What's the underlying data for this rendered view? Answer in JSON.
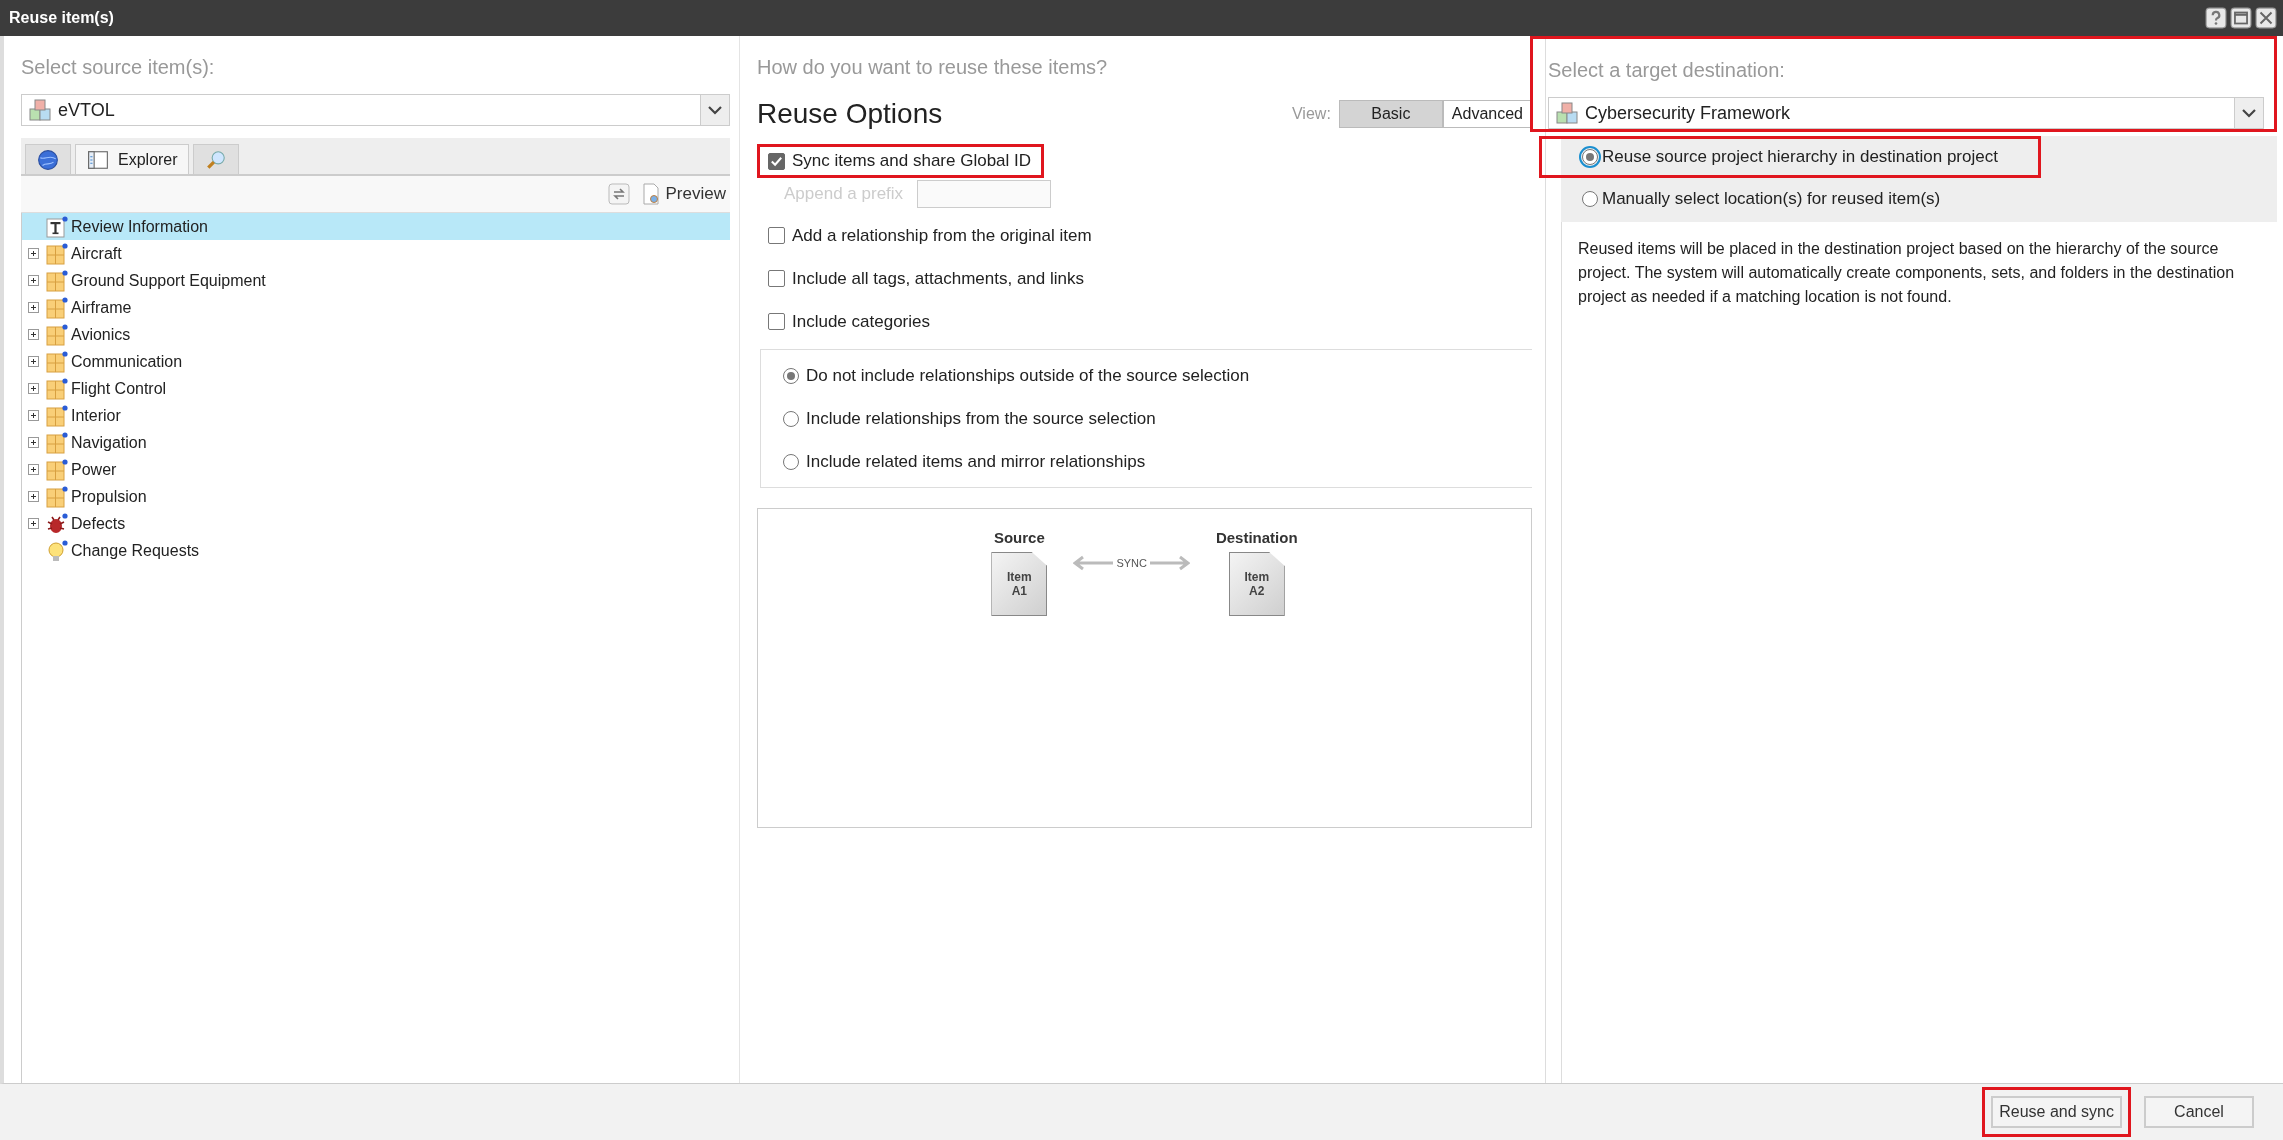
{
  "window": {
    "title": "Reuse item(s)"
  },
  "source": {
    "heading": "Select source item(s):",
    "project": "eVTOL",
    "tabs": [
      {
        "kind": "globe",
        "selected": false
      },
      {
        "kind": "explorer",
        "label": "Explorer",
        "selected": true
      },
      {
        "kind": "search",
        "selected": false
      }
    ],
    "preview": "Preview",
    "tree": [
      {
        "label": "Review Information",
        "kind": "text",
        "expandable": false,
        "selected": true
      },
      {
        "label": "Aircraft",
        "kind": "folder",
        "expandable": true,
        "selected": false
      },
      {
        "label": "Ground Support Equipment",
        "kind": "folder",
        "expandable": true,
        "selected": false
      },
      {
        "label": "Airframe",
        "kind": "folder",
        "expandable": true,
        "selected": false
      },
      {
        "label": "Avionics",
        "kind": "folder",
        "expandable": true,
        "selected": false
      },
      {
        "label": "Communication",
        "kind": "folder",
        "expandable": true,
        "selected": false
      },
      {
        "label": "Flight Control",
        "kind": "folder",
        "expandable": true,
        "selected": false
      },
      {
        "label": "Interior",
        "kind": "folder",
        "expandable": true,
        "selected": false
      },
      {
        "label": "Navigation",
        "kind": "folder",
        "expandable": true,
        "selected": false
      },
      {
        "label": "Power",
        "kind": "folder",
        "expandable": true,
        "selected": false
      },
      {
        "label": "Propulsion",
        "kind": "folder",
        "expandable": true,
        "selected": false
      },
      {
        "label": "Defects",
        "kind": "defect",
        "expandable": true,
        "selected": false
      },
      {
        "label": "Change Requests",
        "kind": "request",
        "expandable": false,
        "selected": false
      }
    ]
  },
  "options": {
    "heading": "How do you want to reuse these items?",
    "title": "Reuse Options",
    "view_label": "View:",
    "view_modes": [
      {
        "label": "Basic",
        "selected": true
      },
      {
        "label": "Advanced",
        "selected": false
      }
    ],
    "sync": {
      "label": "Sync items and share Global ID",
      "checked": true,
      "highlighted": true
    },
    "prefix": {
      "label": "Append a prefix",
      "disabled": true
    },
    "checkboxes": [
      {
        "label": "Add a relationship from the original item",
        "checked": false
      },
      {
        "label": "Include all tags, attachments, and links",
        "checked": false
      },
      {
        "label": "Include categories",
        "checked": false
      }
    ],
    "relationships": [
      {
        "label": "Do not include relationships outside of the source selection",
        "selected": true
      },
      {
        "label": "Include relationships from the source selection",
        "selected": false
      },
      {
        "label": "Include related items and mirror relationships",
        "selected": false
      }
    ],
    "diagram": {
      "source_label": "Source",
      "source_item": [
        "Item",
        "A1"
      ],
      "link_label": "SYNC",
      "destination_label": "Destination",
      "destination_item": [
        "Item",
        "A2"
      ]
    }
  },
  "destination": {
    "heading": "Select a target destination:",
    "project": "Cybersecurity Framework",
    "highlighted": true,
    "placements": [
      {
        "label": "Reuse source project hierarchy in destination project",
        "selected": true,
        "highlighted": true
      },
      {
        "label": "Manually select location(s) for reused item(s)",
        "selected": false,
        "highlighted": false
      }
    ],
    "description": "Reused items will be placed in the destination project based on the hierarchy of the source project. The system will automatically create components, sets, and folders in the destination project as needed if a matching location is not found."
  },
  "buttons": [
    {
      "label": "Reuse and sync",
      "highlighted": true
    },
    {
      "label": "Cancel",
      "highlighted": false
    }
  ]
}
